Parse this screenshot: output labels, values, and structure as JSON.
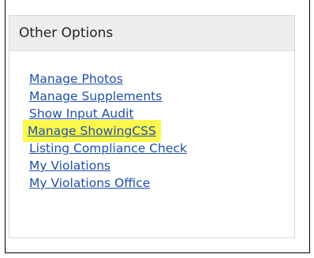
{
  "panel": {
    "title": "Other Options",
    "links": [
      {
        "label": "Manage Photos",
        "highlighted": false
      },
      {
        "label": "Manage Supplements",
        "highlighted": false
      },
      {
        "label": "Show Input Audit",
        "highlighted": false
      },
      {
        "label": "Manage ShowingCSS",
        "highlighted": true
      },
      {
        "label": "Listing Compliance Check",
        "highlighted": false
      },
      {
        "label": "My Violations",
        "highlighted": false
      },
      {
        "label": "My Violations Office",
        "highlighted": false
      }
    ]
  },
  "colors": {
    "link": "#2150a8",
    "highlight": "#fbf84b",
    "header_bg": "#eeeeee"
  }
}
